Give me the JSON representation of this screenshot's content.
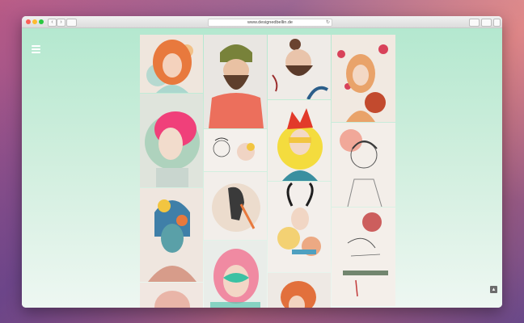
{
  "browser": {
    "url": "www.designedbellin.de",
    "back_icon": "‹",
    "forward_icon": "›",
    "reload_icon": "↻"
  },
  "page": {
    "menu_icon": "hamburger-menu-icon",
    "scroll_top_icon": "▴",
    "accent_bg_top": "#b4e8cf"
  },
  "gallery": {
    "columns": 4,
    "tiles": [
      "red-haired-girl-illustration",
      "bearded-man-beanie-illustration",
      "man-bun-portrait-illustration",
      "girl-with-planets-illustration",
      "pink-haired-girl-illustration",
      "small-faces-sketch",
      "yellow-mask-red-hair-illustration",
      "curly-haired-man-sketch",
      "girl-profile-circle-illustration",
      "horned-figure-collage",
      "blue-helmet-figure-illustration",
      "pink-haired-butterfly-mask-illustration",
      "red-flower-profile-sketch",
      "redhead-partial-bottom"
    ]
  }
}
